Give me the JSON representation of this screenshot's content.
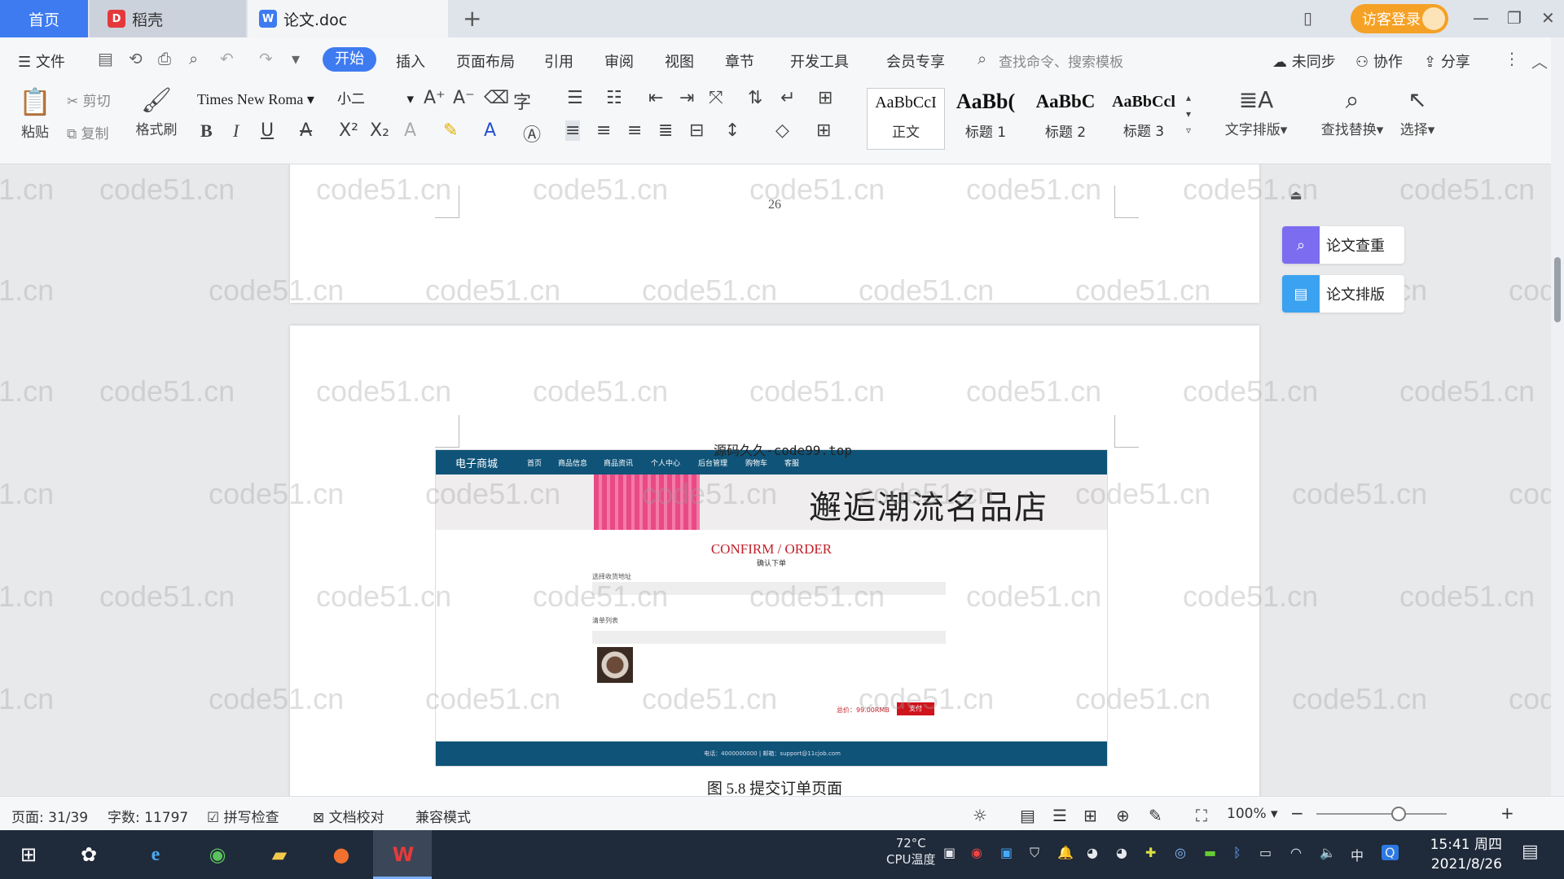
{
  "tabs": [
    {
      "label": "首页"
    },
    {
      "label": "稻壳"
    },
    {
      "label": "论文.doc"
    }
  ],
  "titlebar": {
    "login_label": "访客登录"
  },
  "menu": {
    "file": "文件",
    "items": [
      "开始",
      "插入",
      "页面布局",
      "引用",
      "审阅",
      "视图",
      "章节",
      "开发工具",
      "会员专享"
    ],
    "search_placeholder": "查找命令、搜索模板",
    "sync": "未同步",
    "collab": "协作",
    "share": "分享"
  },
  "ribbon": {
    "paste": "粘贴",
    "cut": "剪切",
    "copy": "复制",
    "format_painter": "格式刷",
    "font": "Times New Roma",
    "size": "小二",
    "styles": [
      {
        "sample": "AaBbCcI",
        "name": "正文"
      },
      {
        "sample": "AaBb(",
        "name": "标题 1"
      },
      {
        "sample": "AaBbC",
        "name": "标题 2"
      },
      {
        "sample": "AaBbCcl",
        "name": "标题 3"
      }
    ],
    "text_layout": "文字排版",
    "find_replace": "查找替换",
    "select": "选择"
  },
  "document": {
    "page_number": "26",
    "watermark": "code51.cn",
    "figure_stamp": "源码久久-code99.top",
    "caption": "图 5.8  提交订单页面",
    "figure": {
      "brand": "电子商城",
      "nav": [
        "首页",
        "商品信息",
        "商品资讯",
        "个人中心",
        "后台管理",
        "购物车",
        "客服"
      ],
      "slogan": "邂逅潮流名品店",
      "title": "CONFIRM / ORDER",
      "subtitle": "确认下单",
      "address_label": "选择收货地址",
      "list_label": "清单列表",
      "total": "总价：99.00RMB",
      "pay": "支付"
    }
  },
  "side_panel": {
    "check": "论文查重",
    "layout": "论文排版"
  },
  "status": {
    "page": "页面: 31/39",
    "words": "字数: 11797",
    "spell": "拼写检查",
    "proof": "文档校对",
    "compat": "兼容模式",
    "zoom": "100%"
  },
  "taskbar": {
    "temp": "72°C",
    "cpu": "CPU温度",
    "ime": "中",
    "time": "15:41 周四",
    "date": "2021/8/26"
  },
  "colors": {
    "accent": "#3e7bf1",
    "login": "#f5a125",
    "figure_nav": "#0f5378",
    "figure_red": "#c0202a"
  }
}
